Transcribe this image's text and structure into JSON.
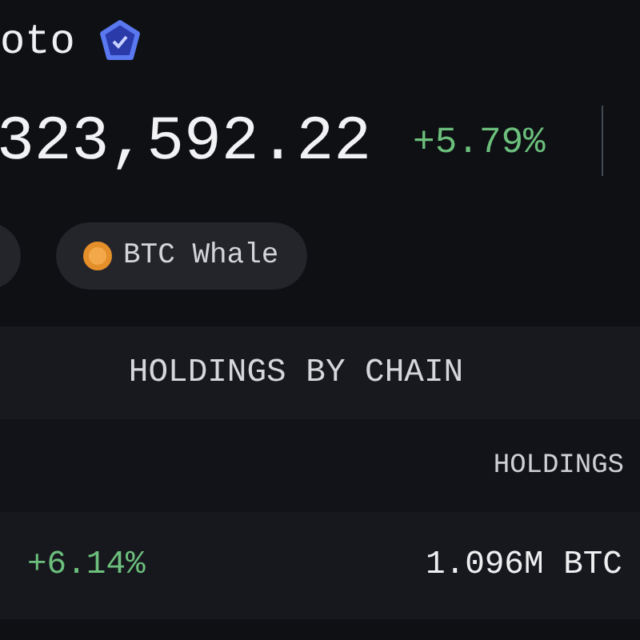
{
  "profile": {
    "name": "oto",
    "verified": true
  },
  "balance": {
    "value": "323,592.22",
    "change": "+5.79%"
  },
  "tags": [
    {
      "kind": "partial"
    },
    {
      "kind": "coin",
      "label": "BTC Whale"
    }
  ],
  "holdings": {
    "title": "HOLDINGS BY CHAIN",
    "columns": [
      "HOLDINGS"
    ],
    "rows": [
      {
        "change": "+6.14%",
        "holdings": "1.096M BTC"
      }
    ]
  }
}
